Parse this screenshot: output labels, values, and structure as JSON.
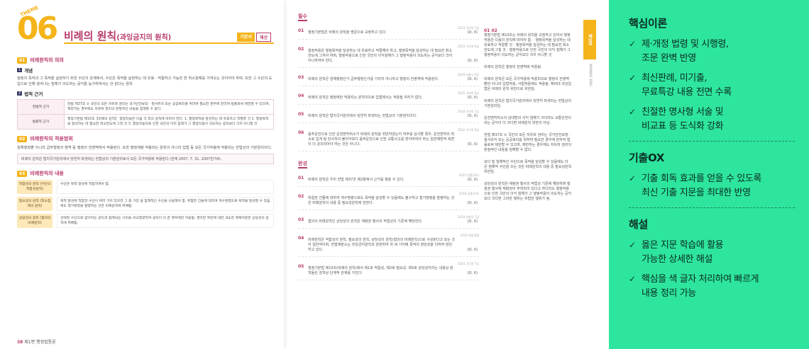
{
  "left_page": {
    "chapter_number": "06",
    "chapter_theme": "THEME",
    "title": "비례의 원칙",
    "title_sub": "(과잉금지의 원칙)",
    "tags": [
      "기본서",
      "재선"
    ],
    "sec1": {
      "num": "01",
      "title": "비례원칙의 의의",
      "sub1_num": "1",
      "sub1_title": "개념",
      "sub1_text": "행정의 목적과 그 목적을 실현하기 위한 수단의 관계에서, 수단은 목적을 실현하는 데 유효 · 적절하고 가능한 한 최소침해를 가져오는 것이어야 하며, 또한 그 수단의 도입으로 인해 생겨나는 침해가 의도하는 공익을 능가하여서는 안 된다는 원칙",
      "sub2_num": "2",
      "sub2_title": "법적 근거",
      "rows": [
        {
          "label": "헌법적 근거",
          "text": "헌법 제37조 ② 국민의 모든 자유와 권리는 국가안전보장 · 질서유지 또는 공공복리를 위하여 필요한 경우에 한하여 법률로써 제한할 수 있으며, 제한하는 경우에도 자유와 권리의 본질적인 내용을 침해할 수 없다."
        },
        {
          "label": "법률적 근거",
          "text": "행정기본법 제10조【비례의 원칙】 행정작용은 다음 각 호의 원칙에 따라야 한다. 1. 행정목적을 달성하는 데 유효하고 적절할 것 2. 행정목적을 달성하는 데 필요한 최소한도에 그칠 것 3. 행정작용으로 인한 국민의 이익 침해가 그 행정작용이 의도하는 공익보다 크지 아니할 것"
        }
      ]
    },
    "sec2": {
      "num": "02",
      "title": "비례원칙의 적용범위",
      "text": "침해행정뿐 아니라 급부행정의 영역 등 행정의 전영역에서 적용된다. 또한 행정재량 적용되는 원칙이 아니라 입법 등 모든 국가작용에 적용되는 헌법상의 기본원리이다.",
      "note": "비례의 원칙은 법치국가원리에서 당연히 파생되는 헌법상의 기본원리로서 모든 국가작용에 적용된다 (헌재 2007. 7. 31, 2007헌가4)."
    },
    "sec3": {
      "num": "03",
      "title": "비례원칙의 내용",
      "rows": [
        {
          "label": "적합성의 원칙 (수단의 적합성원칙)",
          "text": "수단은 목적 달성에 적합하여야 함."
        },
        {
          "label": "필요성의 원칙 (최소침해의 원칙)",
          "text": "목적 달성에 적합한 수단이 여러 가지 있으면 그 중 가장 덜 침해적인 수단을 사용해야 함. 위험한 건물에 대하여 개수명령으로 목적을 달성할 수 있음에도 철거명령을 발령하는 것은 비례원칙에 위배됨."
        },
        {
          "label": "상당성의 원칙 (협의의 비례원칙)",
          "text": "선택된 수단으로 얻어지는 공익과 침해되는 사익을 비교형량하여 공익이 더 큰 경우에만 허용됨. 경미한 위반에 대한 과도한 제재처분은 상당성의 원칙에 위배됨."
        }
      ]
    },
    "footer_page": "38",
    "footer_text": "제1편 행정법통론"
  },
  "right_page": {
    "must_label": "필수",
    "finish_label": "완성",
    "questions": [
      {
        "num": "01",
        "src": "2023 국가직 7급",
        "text": "행정기본법은 비례의 원칙을 명문으로 규정하고 있다.",
        "ox": "(O, X)"
      },
      {
        "num": "02",
        "src": "2023 국가직 9급",
        "text": "행정작용은 행정목적을 달성하는 데 유효하고 적절해야 하고, 행정목적을 달성하는 데 필요한 최소한도에 그쳐야 하며, 행정작용으로 인한 국민의 이익침해가 그 행정작용이 의도하는 공익보다 크지 아니하여야 한다.",
        "ox": "(O, X)"
      },
      {
        "num": "03",
        "src": "2019 서울시 9급",
        "text": "비례의 원칙은 침해행정인가 급부행정인가를 가리지 아니하고 행정의 전영역에 적용된다.",
        "ox": "(O, X)"
      },
      {
        "num": "04",
        "src": "2020 국회직 8급",
        "text": "비례의 원칙은 행정에만 적용되는 원칙이므로 입법에서는 적용될 여지가 없다.",
        "ox": "(O, X)"
      },
      {
        "num": "05",
        "src": "2018 국가직 7급",
        "text": "비례의 원칙은 법치국가원리에서 당연히 파생되는 헌법상의 기본원리이다.",
        "ox": "(O, X)"
      },
      {
        "num": "06",
        "src": "2022 국가직 9급",
        "text": "음주운전으로 인한 운전면허취소가 비례의 원칙을 위반하였는지 여부를 심사할 경우, 운전면허의 취소로 입게 될 당사자의 불이익보다 음주운전으로 인한 교통사고를 방지하여야 하는 일반예방적 측면이 더 강조되어야 하는 것은 아니다.",
        "ox": "(O, X)"
      }
    ],
    "questions2": [
      {
        "num": "01",
        "src": "2015 경찰(2차)",
        "text": "비례의 원칙은 우리 헌법 제37조 제2항에서 근거를 찾을 수 있다.",
        "ox": "(O, X)"
      },
      {
        "num": "02",
        "src": "2018 경찰(1차)",
        "text": "위험한 건물에 대하여 개수명령으로도 목적을 달성할 수 있음에도 불구하고 철거명령을 발령하는 것은 비례원칙의 내용 중 필요성원칙에 반한다.",
        "ox": "(O, X)"
      },
      {
        "num": "03",
        "src": "2018 지방직 7급",
        "text": "협의의 비례원칙인 상당성의 원칙은 재량권 행사의 적법성의 기준에 해당한다.",
        "ox": "(O, X)"
      },
      {
        "num": "04",
        "src": "2022 해양경찰",
        "text": "비례원칙은 적합성의 원칙, 필요성의 원칙, 상당성의 원칙(협의의 비례원칙)으로 구성된다고 보는 것이 일반적이며, 헌법재판소는 과잉금지원칙과 관련하여 위 세 가지에 목적의 정당성을 더하여 판단하고 있다.",
        "ox": "(O, X)"
      },
      {
        "num": "05",
        "src": "2024 군무원 7급",
        "text": "행정기본법 제10조(비례의 원칙)에서 제1호 적합성, 제2호 필요성, 제3호 상당성이라는 내용상 원칙들은 강학상 단계적 관계를 가진다.",
        "ox": "(O, X)"
      }
    ],
    "answers": [
      {
        "num": "01 02",
        "text": "행정기본법 제10조는 비례의 원칙을 규정하고 있어서 행정작용은 다음의 원칙에 따라야 함. · 행정목적을 달성하는 데 유효하고 적절할 것 · 행정목적을 달성하는 데 필요한 최소한도에 그칠 것 · 행정작용으로 인한 국민의 이익 침해가 그 행정작용이 의도하는 공익보다 크지 아니할 것"
      },
      {
        "num": "",
        "text": "비례의 원칙은 행정의 전영역에 적용됨."
      },
      {
        "num": "",
        "text": "비례의 원칙은 모든 국가작용에 적용되므로 행정의 전영역뿐만 아니라 입법작용, 사법작용에도 적용됨. 헤비대 과잉입법은 비례의 원칙 위반으로 위헌임."
      },
      {
        "num": "",
        "text": "비례의 원칙은 법치국가원리에서 당연히 파생되는 헌법상의 기본원리임."
      },
      {
        "num": "",
        "text": "운전면허취소의 상대방의 사익 침해가 크더라도 교통안전이라는 공익이 더 크다면 비례원칙 위반이 아님."
      },
      {
        "num": "",
        "text": "헌법 제37조 ② 국민의 모든 자유와 권리는 국가안전보장 · 질서유지 또는 공공복리를 위하여 필요한 경우에 한하여 법률로써 제한할 수 있으며, 제한하는 경우에도 자유와 권리의 본질적인 내용을 침해할 수 없다."
      },
      {
        "num": "",
        "text": "보다 덜 침해적인 수단으로 목적을 달성할 수 있음에도 더 큰 침해적 수단을 쓰는 것은 비례원칙의 내용 중 필요성원칙 위반임."
      },
      {
        "num": "",
        "text": "상당성의 원칙은 재량권 행사의 적법성 기준에 해당하며 행정권 행사에 재량권이 부여되어 있다고 하더라도 행정작용으로 인한 국민의 이익 침해가 그 행정작용이 의도하는 공익보다 크다면 그러한 행위는 위법한 행위가 됨."
      }
    ],
    "side_tab": "제2장",
    "side_label": "행정법의 법원"
  },
  "panel": {
    "sections": [
      {
        "title": "핵심이론",
        "items": [
          [
            "제·개정 법령 및 시행령,",
            "조문 완벽 반영"
          ],
          [
            "최신판례, 미기출,",
            "무료특강 내용 전면 수록"
          ],
          [
            "친절한 명사형 서술 및",
            "비교표 등 도식화 강화"
          ]
        ]
      },
      {
        "title": "기출OX",
        "items": [
          [
            "기출 회독 효과를 얻을 수 있도록",
            "최신 기출 지문을 최대한 반영"
          ]
        ]
      },
      {
        "title": "해설",
        "items": [
          [
            "옳은 지문 학습에 활용",
            "가능한 상세한 해설"
          ],
          [
            "핵심을 색 글자 처리하여 빠르게",
            "내용 정리 가능"
          ]
        ]
      }
    ],
    "check_icon": "check-icon",
    "colors": {
      "panel_bg": "#2ee59d",
      "accent_pink": "#b83b6d",
      "accent_yellow": "#f4b41a"
    }
  }
}
